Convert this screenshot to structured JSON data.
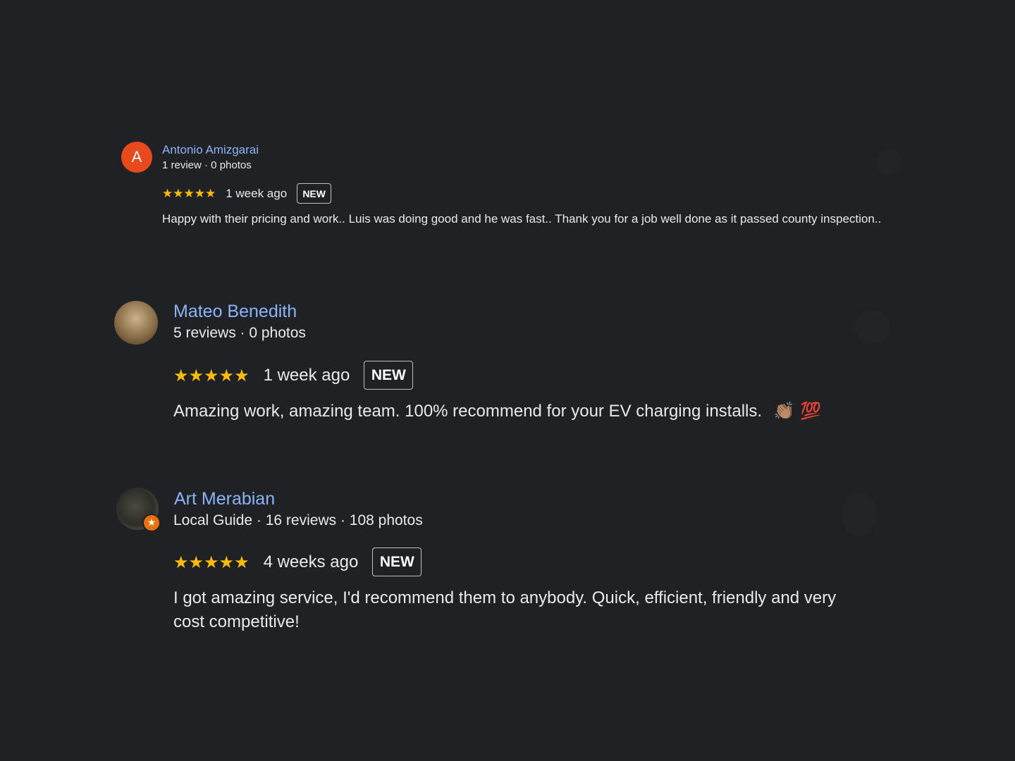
{
  "reviews": [
    {
      "avatar_letter": "A",
      "name": "Antonio Amizgarai",
      "meta": "1 review · 0 photos",
      "stars": "★★★★★",
      "rating": 5,
      "when": "1 week ago",
      "badge": "NEW",
      "text": "Happy with their pricing and work.. Luis was doing good and he was fast.. Thank you for a job well done as it passed county inspection.."
    },
    {
      "name": "Mateo Benedith",
      "meta": "5 reviews · 0 photos",
      "stars": "★★★★★",
      "rating": 5,
      "when": "1 week ago",
      "badge": "NEW",
      "text": "Amazing work, amazing team. 100% recommend for your EV charging installs.",
      "emoji": "👏🏽 💯"
    },
    {
      "name": "Art Merabian",
      "meta": "Local Guide · 16 reviews · 108 photos",
      "stars": "★★★★★",
      "rating": 5,
      "when": "4 weeks ago",
      "badge": "NEW",
      "text": "I got amazing service, I'd recommend them to anybody. Quick, efficient, friendly and very cost competitive!",
      "guide_badge": "★"
    }
  ],
  "colors": {
    "background": "#202124",
    "name_link": "#8ab4f8",
    "star": "#fbbc04",
    "avatar_a": "#e8491d",
    "local_guide_badge": "#e8710a"
  }
}
